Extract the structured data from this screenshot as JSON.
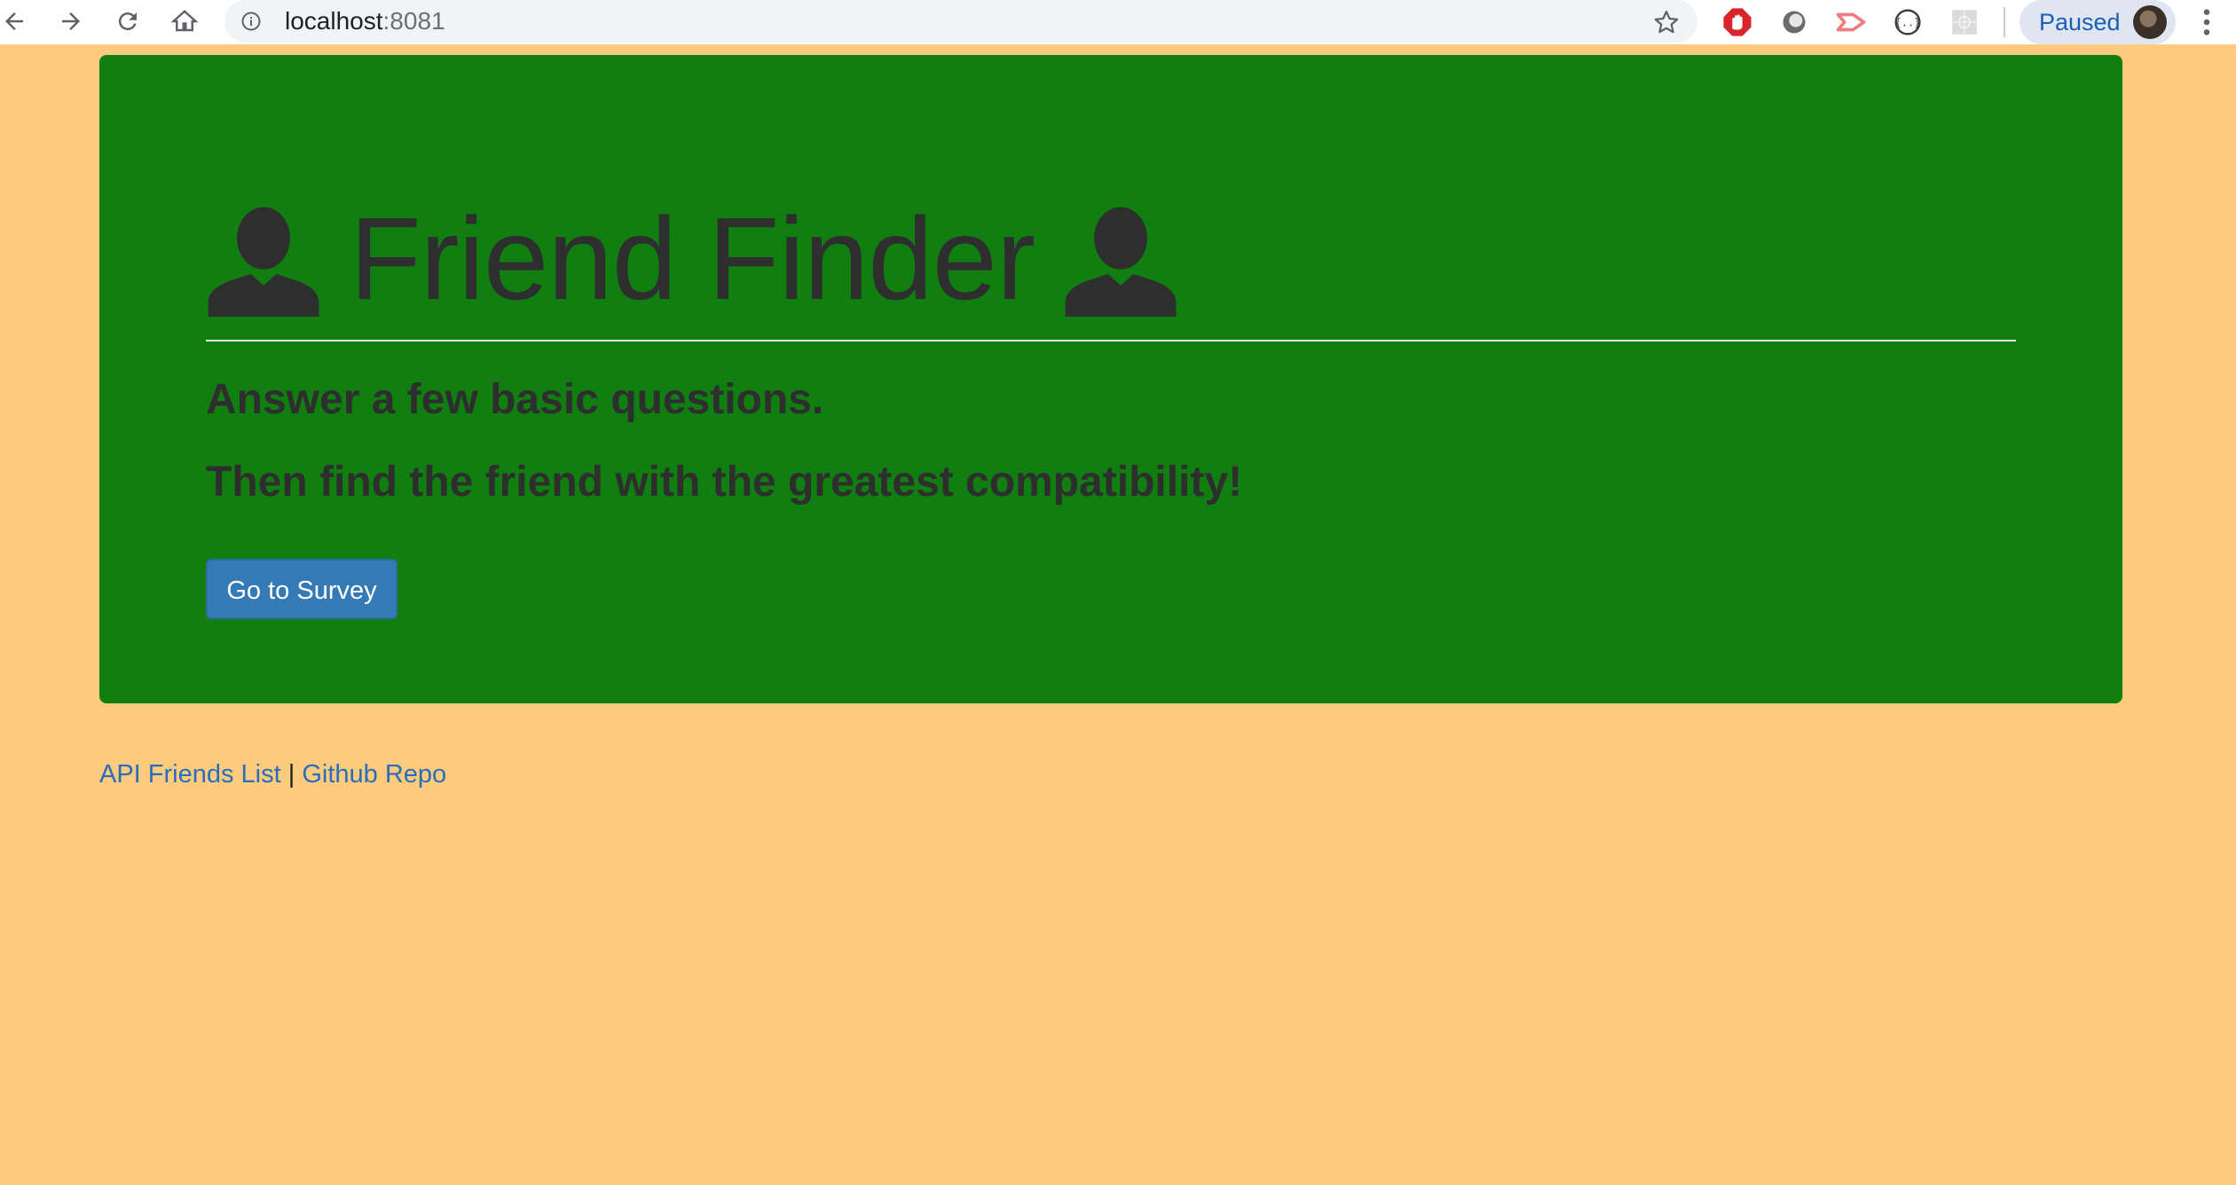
{
  "browser": {
    "url_host": "localhost",
    "url_port": ":8081",
    "profile_status": "Paused",
    "icons": [
      "back-arrow-icon",
      "forward-arrow-icon",
      "reload-icon",
      "home-icon",
      "info-icon",
      "star-icon",
      "adblock-icon",
      "extension-circle-icon",
      "extension-arrow-icon",
      "extension-code-icon",
      "extension-grid-icon",
      "avatar",
      "menu-dots-icon"
    ]
  },
  "hero": {
    "title": "Friend Finder",
    "lead_1": "Answer a few basic questions.",
    "lead_2": "Then find the friend with the greatest compatibility!",
    "button_label": "Go to Survey",
    "icon": "user-icon"
  },
  "footer": {
    "link_1": "API Friends List",
    "separator": "|",
    "link_2": "Github Repo"
  },
  "colors": {
    "page_background": "#fccb7d",
    "jumbotron_background": "#107e10",
    "button_background": "#337ab7",
    "link": "#2a6ebb",
    "text": "#2e2e2e"
  }
}
